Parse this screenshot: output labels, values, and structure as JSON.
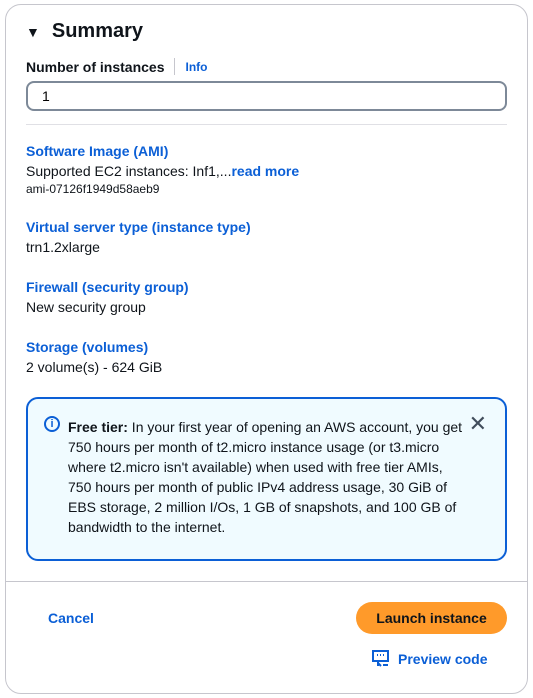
{
  "summary": {
    "title": "Summary",
    "number_label": "Number of instances",
    "info": "Info",
    "number_value": "1"
  },
  "sections": [
    {
      "title": "Software Image (AMI)",
      "value": "Supported EC2 instances: Inf1,...",
      "more": "read more",
      "meta": "ami-07126f1949d58aeb9"
    },
    {
      "title": "Virtual server type (instance type)",
      "value": "trn1.2xlarge"
    },
    {
      "title": "Firewall (security group)",
      "value": "New security group"
    },
    {
      "title": "Storage (volumes)",
      "value": "2 volume(s) - 624 GiB"
    }
  ],
  "alert": {
    "bold": "Free tier:",
    "text": " In your first year of opening an AWS account, you get 750 hours per month of t2.micro instance usage (or t3.micro where t2.micro isn't available) when used with free tier AMIs, 750 hours per month of public IPv4 address usage, 30 GiB of EBS storage, 2 million I/Os, 1 GB of snapshots, and 100 GB of bandwidth to the internet."
  },
  "footer": {
    "cancel": "Cancel",
    "launch": "Launch instance",
    "preview": "Preview code"
  },
  "colors": {
    "accent": "#0b5fd6",
    "primary_button": "#ff9a2a",
    "alert_bg": "#f0fbff"
  }
}
